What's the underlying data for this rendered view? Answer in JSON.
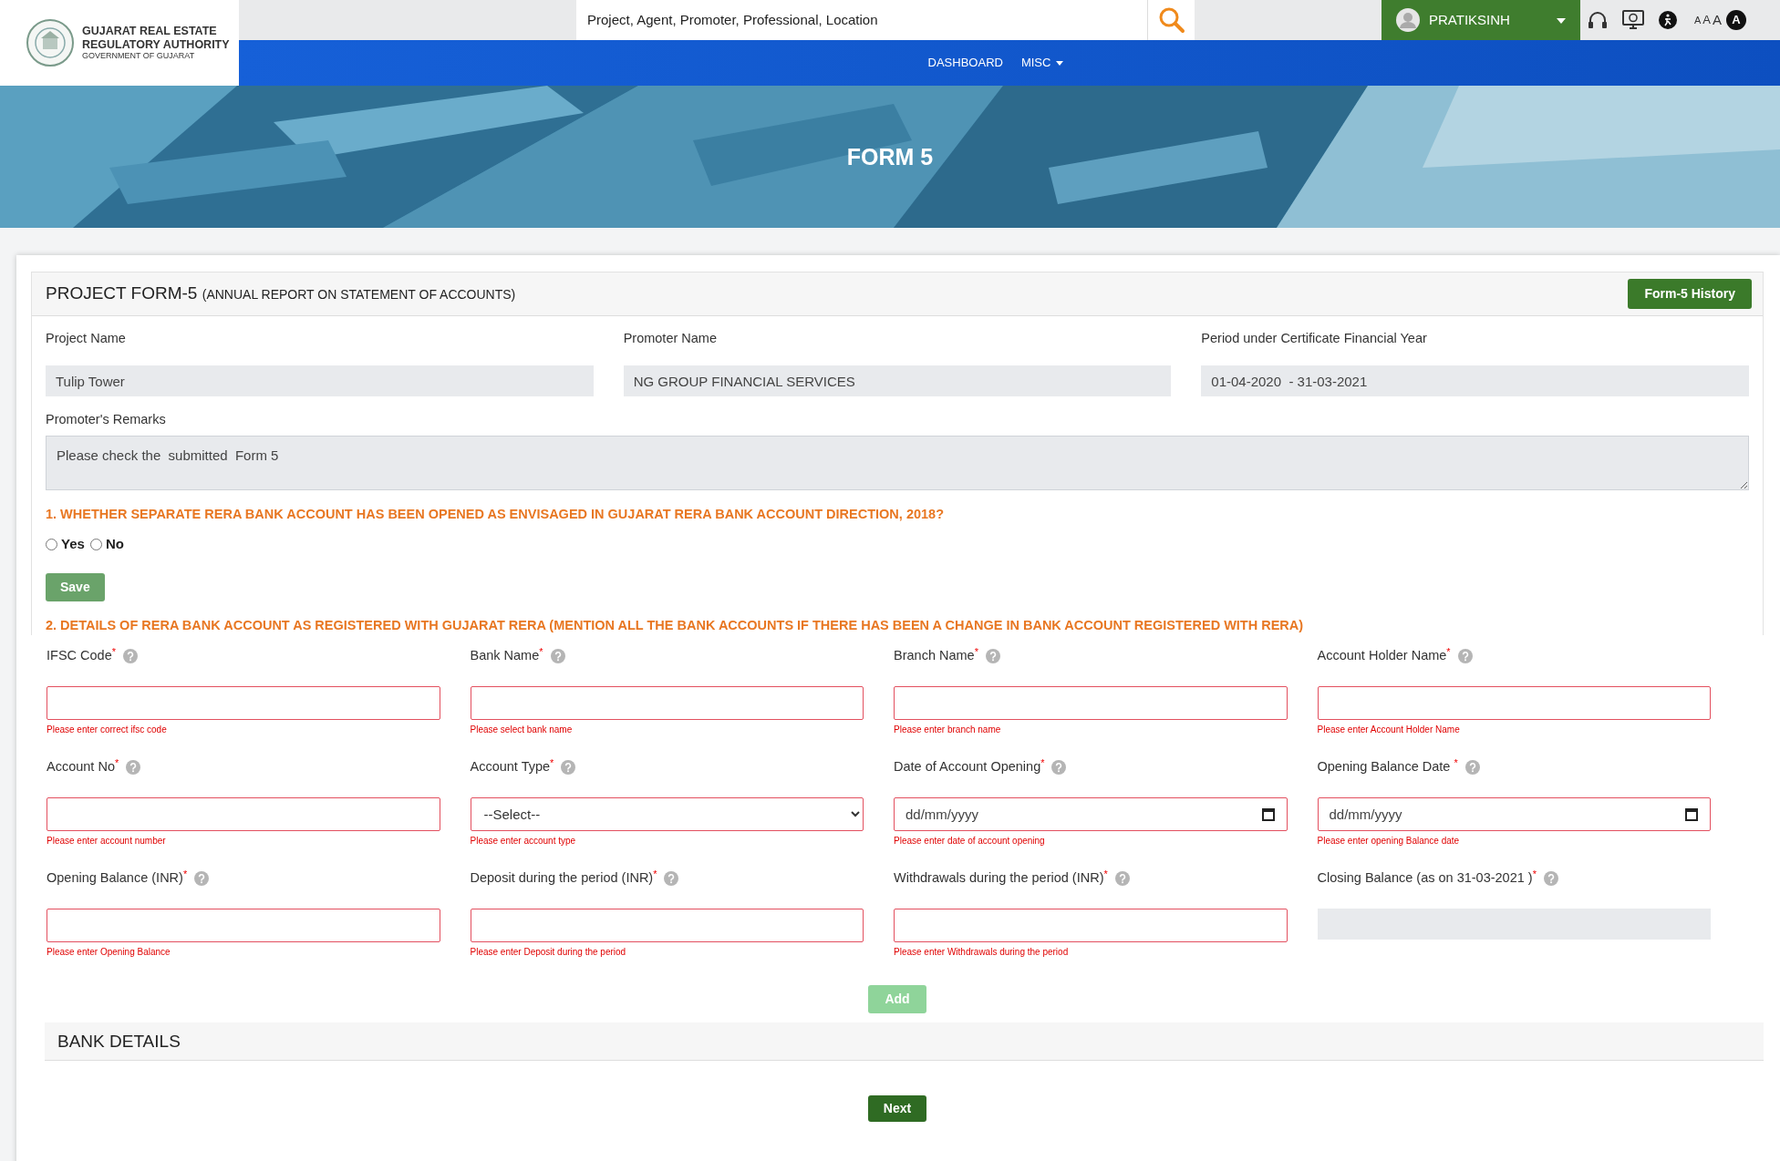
{
  "header": {
    "logo_lines": [
      "GUJARAT REAL ESTATE",
      "REGULATORY AUTHORITY",
      "GOVERNMENT OF GUJARAT"
    ],
    "search": {
      "placeholder": "Project, Agent, Promoter, Professional, Location"
    },
    "user": "PRATIKSINH",
    "font_sizes": [
      "A",
      "A",
      "A"
    ],
    "contrast": "A"
  },
  "nav": [
    {
      "label": "DASHBOARD",
      "dropdown": false
    },
    {
      "label": "MISC",
      "dropdown": true
    }
  ],
  "banner": {
    "title": "FORM 5"
  },
  "card": {
    "title": "PROJECT FORM-5",
    "subtitle": "(ANNUAL REPORT ON STATEMENT OF ACCOUNTS)",
    "history_button": "Form-5 History"
  },
  "info_fields": [
    {
      "label": "Project Name",
      "value": "Tulip Tower"
    },
    {
      "label": "Promoter Name",
      "value": "NG GROUP FINANCIAL SERVICES"
    },
    {
      "label": "Period under Certificate Financial Year",
      "value": "01-04-2020  - 31-03-2021"
    }
  ],
  "remarks": {
    "label": "Promoter's Remarks",
    "value": "Please check the  submitted  Form 5"
  },
  "question_1": {
    "text": "1. WHETHER SEPARATE RERA BANK ACCOUNT HAS BEEN OPENED AS ENVISAGED IN GUJARAT RERA BANK ACCOUNT DIRECTION, 2018?",
    "options": [
      {
        "label": "Yes",
        "selected": false
      },
      {
        "label": "No",
        "selected": false
      }
    ],
    "save_button": "Save"
  },
  "question_2": {
    "text": "2. DETAILS OF RERA BANK ACCOUNT AS REGISTERED WITH GUJARAT RERA (MENTION ALL THE BANK ACCOUNTS IF THERE HAS BEEN A CHANGE IN BANK ACCOUNT REGISTERED WITH RERA)"
  },
  "bank_fields": [
    {
      "kind": "text",
      "label": "IFSC Code$^{*}$",
      "error": "Please enter correct ifsc code"
    },
    {
      "kind": "text",
      "label": "Bank Name$^{*}$",
      "error": "Please select bank name"
    },
    {
      "kind": "text",
      "label": "Branch Name$^{*}$",
      "error": "Please enter branch name"
    },
    {
      "kind": "text",
      "label": "Account Holder Name$^{*}$",
      "error": "Please enter Account Holder Name"
    },
    {
      "kind": "text",
      "label": "Account No$^{*}$",
      "error": "Please enter account number"
    },
    {
      "kind": "select",
      "label": "Account Type$^{*}$",
      "value": "--Select--",
      "error": "Please enter account type"
    },
    {
      "kind": "date",
      "label": "Date of Account Opening$^{*}$",
      "placeholder": "dd/mm/yyyy",
      "error": "Please enter date of account opening"
    },
    {
      "kind": "date",
      "label": "Opening Balance Date $^{*}$",
      "placeholder": "dd/mm/yyyy",
      "error": "Please enter opening Balance date"
    },
    {
      "kind": "text",
      "label": "Opening Balance (INR)$^{*}$",
      "error": "Please enter Opening Balance"
    },
    {
      "kind": "text",
      "label": "Deposit during the period (INR)$^{*}$",
      "error": "Please enter Deposit during the period"
    },
    {
      "kind": "text",
      "label": "Withdrawals during the period (INR)$^{*}$",
      "error": "Please enter Withdrawals during the period"
    },
    {
      "kind": "readonly",
      "label": "Closing Balance (as on 31-03-2021 )$^{*}$"
    }
  ],
  "add_button": {
    "label": "Add",
    "disabled": true
  },
  "bank_details": {
    "title": "BANK DETAILS"
  },
  "next_button": "Next"
}
